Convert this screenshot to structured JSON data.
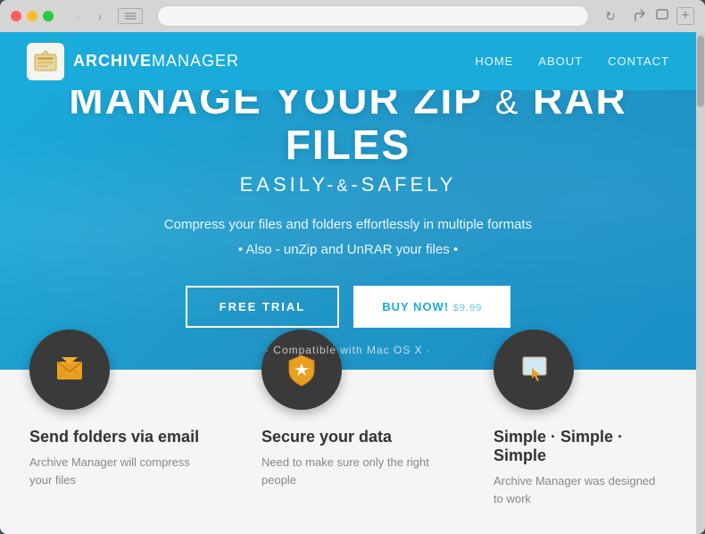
{
  "browser": {
    "addressbar_text": "",
    "add_tab_label": "+"
  },
  "site": {
    "logo_text_bold": "ARCHIVE",
    "logo_text_light": "MANAGER",
    "nav": {
      "items": [
        {
          "label": "HOME",
          "id": "home"
        },
        {
          "label": "ABOUT",
          "id": "about"
        },
        {
          "label": "CONTACT",
          "id": "contact"
        }
      ]
    },
    "hero": {
      "title_line1": "MANAGE YOUR ZIP",
      "title_ampersand": "&",
      "title_line2": "RAR FILES",
      "subtitle": "EASILY",
      "subtitle_amp": "&",
      "subtitle_end": "SAFELY",
      "description1": "Compress your files and folders effortlessly in multiple formats",
      "description2": "• Also - unZip and UnRAR your files •",
      "btn_trial": "FREE TRIAL",
      "btn_buy": "BUY NOW!",
      "btn_price": "$9.99",
      "compat": "· Compatible with Mac OS X ·"
    },
    "features": [
      {
        "id": "email",
        "title": "Send folders via email",
        "description": "Archive Manager will compress your files",
        "icon": "envelope"
      },
      {
        "id": "secure",
        "title": "Secure your data",
        "description": "Need to make sure only the right people",
        "icon": "shield"
      },
      {
        "id": "simple",
        "title": "Simple · Simple · Simple",
        "description": "Archive Manager was designed to work",
        "icon": "cursor"
      }
    ]
  }
}
